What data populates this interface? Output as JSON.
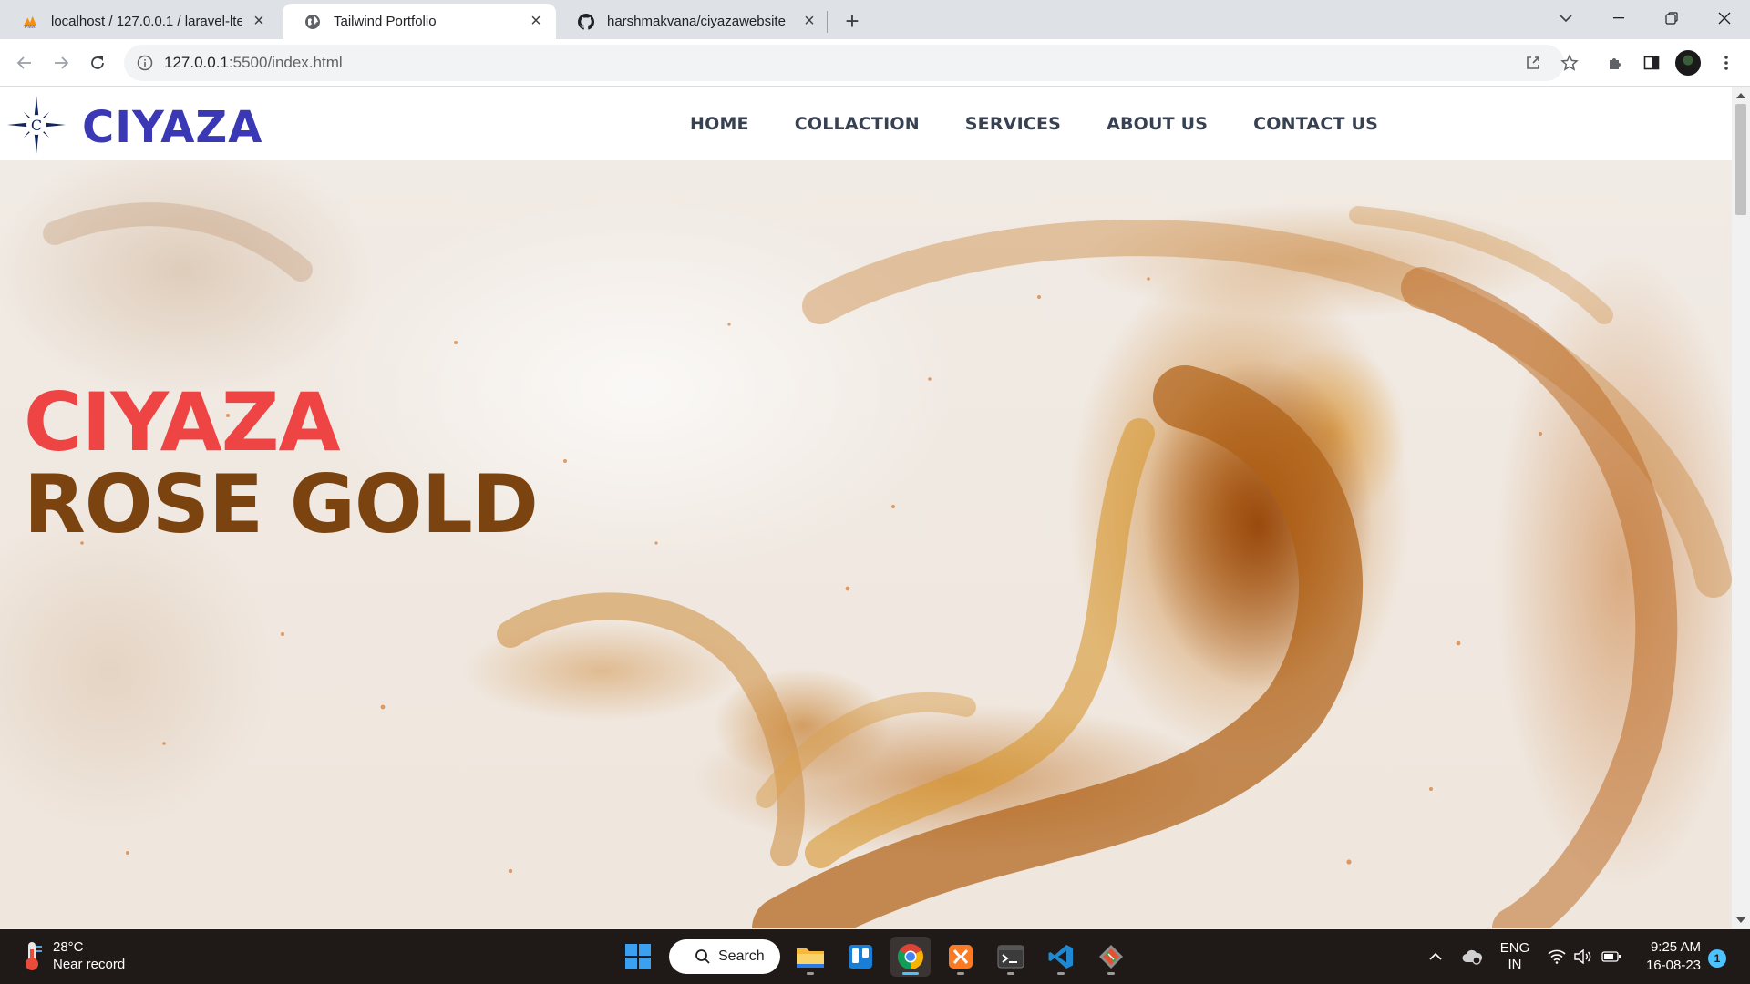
{
  "browser": {
    "tabs": [
      {
        "title": "localhost / 127.0.0.1 / laravel-lte",
        "favicon": "phpmyadmin-icon",
        "active": false
      },
      {
        "title": "Tailwind Portfolio",
        "favicon": "globe-icon",
        "active": true
      },
      {
        "title": "harshmakvana/ciyazawebsite",
        "favicon": "github-icon",
        "active": false
      }
    ],
    "address": {
      "host": "127.0.0.1",
      "path": ":5500/index.html"
    }
  },
  "site": {
    "brand": "CIYAZA",
    "nav": [
      "HOME",
      "COLLACTION",
      "SERVICES",
      "ABOUT US",
      "CONTACT US"
    ],
    "hero": {
      "line1": "CIYAZA",
      "line2": "ROSE GOLD"
    },
    "colors": {
      "brand": "#3b38b6",
      "line1": "#ef4444",
      "line2": "#7a4310"
    }
  },
  "taskbar": {
    "weather": {
      "temp": "28°C",
      "desc": "Near record"
    },
    "search_label": "Search",
    "lang": {
      "line1": "ENG",
      "line2": "IN"
    },
    "time": "9:25 AM",
    "date": "16-08-23",
    "notifications": "1"
  }
}
